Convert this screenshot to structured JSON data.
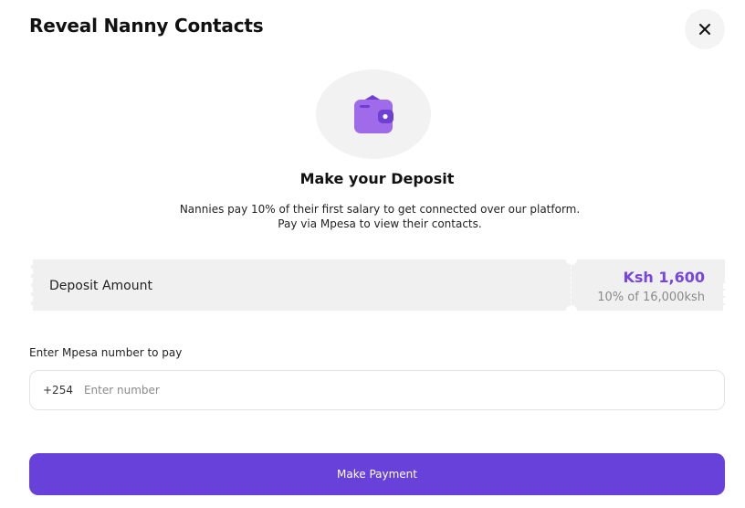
{
  "modal": {
    "title": "Reveal Nanny Contacts",
    "close_icon": "close-icon"
  },
  "hero": {
    "icon": "wallet-icon",
    "heading": "Make your Deposit",
    "description_line1": "Nannies pay 10% of their first salary to get connected over our platform.",
    "description_line2": "Pay via Mpesa to view their contacts."
  },
  "deposit": {
    "label": "Deposit Amount",
    "amount": "Ksh 1,600",
    "breakdown": "10% of 16,000ksh"
  },
  "payment": {
    "field_label": "Enter Mpesa number to pay",
    "country_prefix": "+254",
    "placeholder": "Enter number",
    "value": "",
    "button_label": "Make Payment"
  },
  "colors": {
    "accent": "#6741d9",
    "amount": "#7546e0",
    "wallet": "#9f6bea"
  }
}
